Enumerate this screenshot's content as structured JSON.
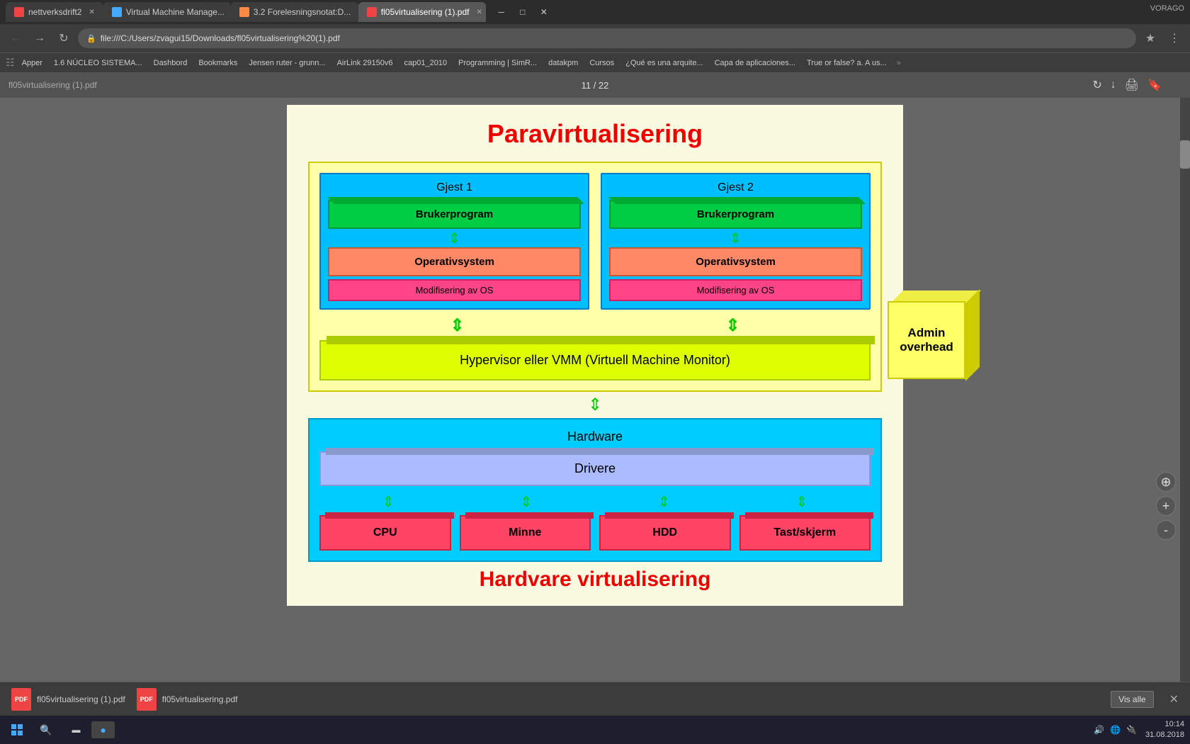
{
  "browser": {
    "tabs": [
      {
        "label": "nettverksdrift2",
        "favicon": "red",
        "active": false
      },
      {
        "label": "Virtual Machine Manage...",
        "favicon": "blue",
        "active": false
      },
      {
        "label": "3.2 Forelesningsnotat:D...",
        "favicon": "orange",
        "active": false
      },
      {
        "label": "fl05virtualisering (1).pdf",
        "favicon": "red",
        "active": true
      }
    ],
    "address": "file:///C:/Users/zvagui15/Downloads/fl05virtualisering%20(1).pdf",
    "bookmarks": [
      "1.6 NÚCLEO SISTEMA...",
      "Dashbord",
      "Bookmarks",
      "Jensen ruter - grunn...",
      "AirLink 29150v6",
      "cap01_2010",
      "Programming | SimR...",
      "datakpm",
      "Cursos",
      "¿Qué es una arquite...",
      "Capa de aplicaciones...",
      "True or false? a. A us..."
    ]
  },
  "pdf": {
    "toolbar": {
      "filename": "fl05virtualisering (1).pdf",
      "page_current": "11",
      "page_total": "22",
      "page_label": "11 / 22"
    },
    "diagram": {
      "title": "Paravirtualisering",
      "guest1_label": "Gjest 1",
      "guest2_label": "Gjest 2",
      "brukerprogram": "Brukerprogram",
      "operativsystem": "Operativsystem",
      "modifisering": "Modifisering av OS",
      "hypervisor": "Hypervisor eller VMM (Virtuell Machine Monitor)",
      "hardware_label": "Hardware",
      "drivere_label": "Drivere",
      "cpu_label": "CPU",
      "minne_label": "Minne",
      "hdd_label": "HDD",
      "tastskjerm_label": "Tast/skjerm",
      "admin_overhead": "Admin overhead",
      "bottom_text": "Hardvare virtualisering"
    }
  },
  "downloads": [
    {
      "name": "fl05virtualisering (1).pdf",
      "icon_color": "#e44"
    },
    {
      "name": "fl05virtualisering.pdf",
      "icon_color": "#e44"
    }
  ],
  "download_bar": {
    "vis_alle": "Vis alle",
    "close_label": "✕"
  },
  "taskbar": {
    "datetime": "10:14",
    "date": "31.08.2018",
    "items": []
  },
  "zoom_controls": {
    "zoom_in": "+",
    "zoom_out": "-",
    "move": "⊕"
  }
}
